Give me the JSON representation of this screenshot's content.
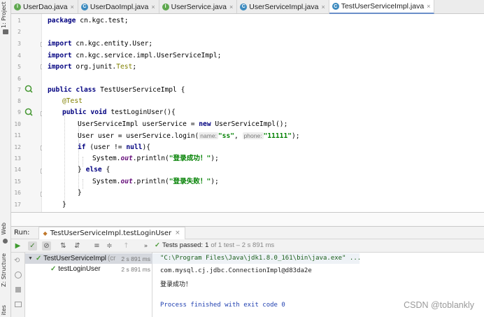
{
  "left_strip": {
    "project_label": "1: Project",
    "web_label": "Web",
    "structure_label": "Z: Structure",
    "favorites_label": "ites"
  },
  "tabs": [
    {
      "label": "UserDao.java",
      "icon": "i"
    },
    {
      "label": "UserDaoImpl.java",
      "icon": "c"
    },
    {
      "label": "UserService.java",
      "icon": "i"
    },
    {
      "label": "UserServiceImpl.java",
      "icon": "c"
    },
    {
      "label": "TestUserServiceImpl.java",
      "icon": "c",
      "active": true
    }
  ],
  "editor": {
    "line_numbers": [
      "1",
      "2",
      "3",
      "4",
      "5",
      "6",
      "7",
      "8",
      "9",
      "10",
      "11",
      "12",
      "13",
      "14",
      "15",
      "16",
      "17"
    ],
    "lines": {
      "l1_kw": "package",
      "l1_rest": " cn.kgc.test;",
      "l3_kw": "import",
      "l3_rest": " cn.kgc.entity.User;",
      "l4_kw": "import",
      "l4_rest": " cn.kgc.service.impl.UserServiceImpl;",
      "l5_kw": "import",
      "l5_rest": " org.junit.",
      "l5_an": "Test",
      "l5_end": ";",
      "l7_kw": "public class",
      "l7_rest": " TestUserServiceImpl {",
      "l8_an": "@Test",
      "l9_kw": "public void",
      "l9_rest": " testLoginUser(){",
      "l10_a": "UserServiceImpl userService = ",
      "l10_kw": "new",
      "l10_b": " UserServiceImpl();",
      "l11_a": "User user = userService.login(",
      "l11_h1": "name:",
      "l11_s1": "\"ss\"",
      "l11_c": ", ",
      "l11_h2": "phone:",
      "l11_s2": "\"11111\"",
      "l11_end": ");",
      "l12_kw": "if",
      "l12_a": " (user != ",
      "l12_kw2": "null",
      "l12_b": "){",
      "l13_a": "System.",
      "l13_f": "out",
      "l13_b": ".println(",
      "l13_s": "\"登录成功！\"",
      "l13_end": ");",
      "l14_a": "} ",
      "l14_kw": "else",
      "l14_b": " {",
      "l15_a": "System.",
      "l15_f": "out",
      "l15_b": ".println(",
      "l15_s": "\"登录失败！\"",
      "l15_end": ");",
      "l16": "}",
      "l17": "}"
    }
  },
  "run": {
    "label": "Run:",
    "config_tab": "TestUserServiceImpl.testLoginUser",
    "tests_passed": "Tests passed:",
    "passed_count": "1",
    "passed_detail": "of 1 test – 2 s 891 ms",
    "tree": [
      {
        "label": "TestUserServiceImpl",
        "suffix": "(cr",
        "time": "2 s 891 ms"
      },
      {
        "label": "testLoginUser",
        "time": "2 s 891 ms"
      }
    ],
    "console": [
      "\"C:\\Program Files\\Java\\jdk1.8.0_161\\bin\\java.exe\" ...",
      "com.mysql.cj.jdbc.ConnectionImpl@d83da2e",
      "登录成功！",
      "",
      "Process finished with exit code 0"
    ]
  },
  "watermark": "CSDN @toblankly",
  "colors": {
    "keyword": "#000080",
    "string": "#008000",
    "annotation": "#808000",
    "field": "#660e7a",
    "pass_green": "#4a9a37",
    "console_blue": "#1f3fb0",
    "console_path": "#1a5e1a"
  }
}
